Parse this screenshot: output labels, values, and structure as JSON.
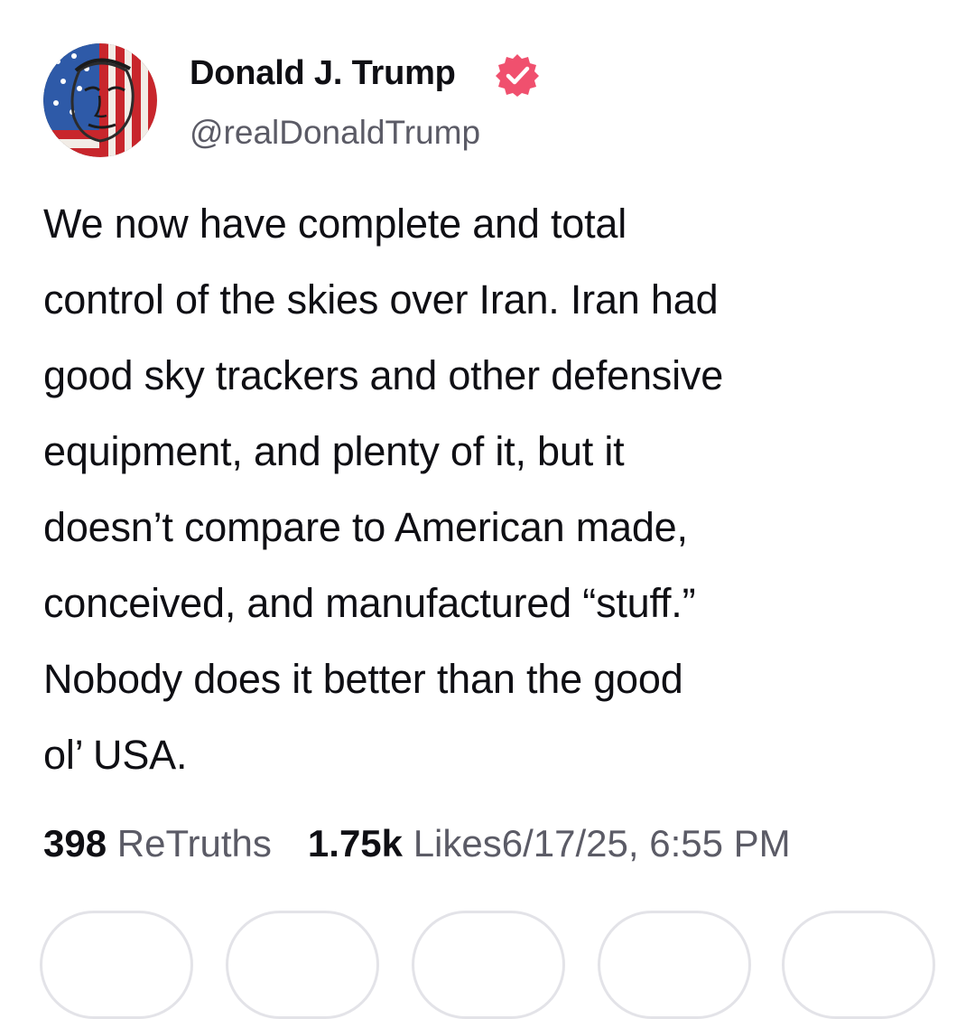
{
  "post": {
    "author": {
      "display_name": "Donald J. Trump",
      "handle": "@realDonaldTrump",
      "verified": true,
      "verified_color": "#f0506e"
    },
    "body_lines": [
      "We now have complete and total",
      "control of the skies over Iran. Iran had",
      "good sky trackers and other defensive",
      "equipment, and plenty of it, but it",
      "doesn’t compare to American made,",
      "conceived, and manufactured “stuff.”",
      "Nobody does it better than the good",
      "ol’ USA."
    ],
    "stats": {
      "retruths_count": "398",
      "retruths_label": "ReTruths",
      "likes_count": "1.75k",
      "likes_label": "Likes"
    },
    "timestamp": "6/17/25, 6:55 PM"
  },
  "action_bar": {
    "buttons": [
      {
        "icon": "reply-icon"
      },
      {
        "icon": "retruth-icon"
      },
      {
        "icon": "like-icon"
      },
      {
        "icon": "share-icon"
      },
      {
        "icon": "more-icon"
      }
    ]
  }
}
